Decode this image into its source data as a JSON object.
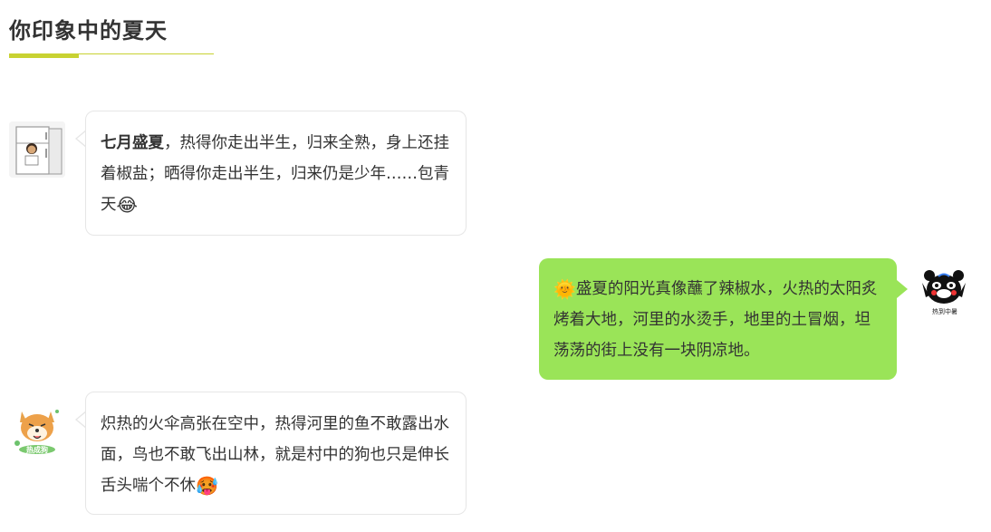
{
  "header": {
    "title": "你印象中的夏天"
  },
  "colors": {
    "accent": "#c8d232",
    "bubble_right": "#9ae458",
    "bubble_left_border": "#e6e6e6",
    "text": "#333333"
  },
  "messages": [
    {
      "side": "left",
      "avatar_icon": "refrigerator-man-avatar",
      "lead": "七月盛夏",
      "text": "，热得你走出半生，归来全熟，身上还挂着椒盐；晒得你走出半生，归来仍是少年……包青天",
      "trailing_emoji": "😂",
      "trailing_emoji_name": "laughing-crying-emoji"
    },
    {
      "side": "right",
      "avatar_icon": "kumamon-avatar",
      "avatar_caption": "热到中暑",
      "leading_emoji": "🌞",
      "leading_emoji_name": "sun-emoji",
      "text": "盛夏的阳光真像蘸了辣椒水，火热的太阳炙烤着大地，河里的水烫手，地里的土冒烟，坦荡荡的街上没有一块阴凉地。"
    },
    {
      "side": "left",
      "avatar_icon": "shiba-dog-avatar",
      "avatar_caption": "热成狗",
      "text": "炽热的火伞高张在空中，热得河里的鱼不敢露出水面，鸟也不敢飞出山林，就是村中的狗也只是伸长舌头喘个不休",
      "trailing_emoji": "🥵",
      "trailing_emoji_name": "husky-tongue-emoji"
    }
  ]
}
